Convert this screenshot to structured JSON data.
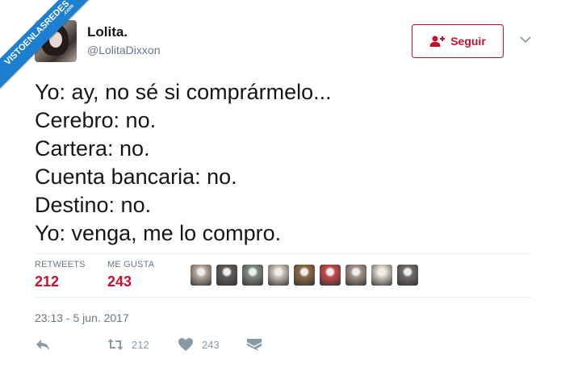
{
  "watermark": {
    "text": "VISTOENLASREDES",
    "sub": ".com"
  },
  "user": {
    "name": "Lolita.",
    "handle": "@LolitaDixxon"
  },
  "follow_button": {
    "label": "Seguir"
  },
  "tweet": {
    "lines": [
      "Yo: ay, no sé si comprármelo...",
      "Cerebro: no.",
      "Cartera: no.",
      "Cuenta bancaria: no.",
      "Destino: no.",
      "Yo: venga, me lo compro."
    ],
    "timestamp": "23:13 - 5 jun. 2017"
  },
  "stats": {
    "retweets_label": "RETWEETS",
    "retweets": "212",
    "likes_label": "ME GUSTA",
    "likes": "243"
  },
  "liker_avatars": [
    "#b9a89c",
    "#5e5a58",
    "#7d8a7f",
    "#c9c2b7",
    "#8d6a45",
    "#c9474a",
    "#a59488",
    "#d8d1c6",
    "#6f6b69"
  ],
  "actions": {
    "icons": [
      "reply-icon",
      "retweet-icon",
      "heart-icon",
      "message-icon"
    ],
    "retweet_count": "212",
    "like_count": "243"
  },
  "colors": {
    "accent": "#c8102e",
    "muted": "#657786",
    "icon": "#8899a6"
  }
}
